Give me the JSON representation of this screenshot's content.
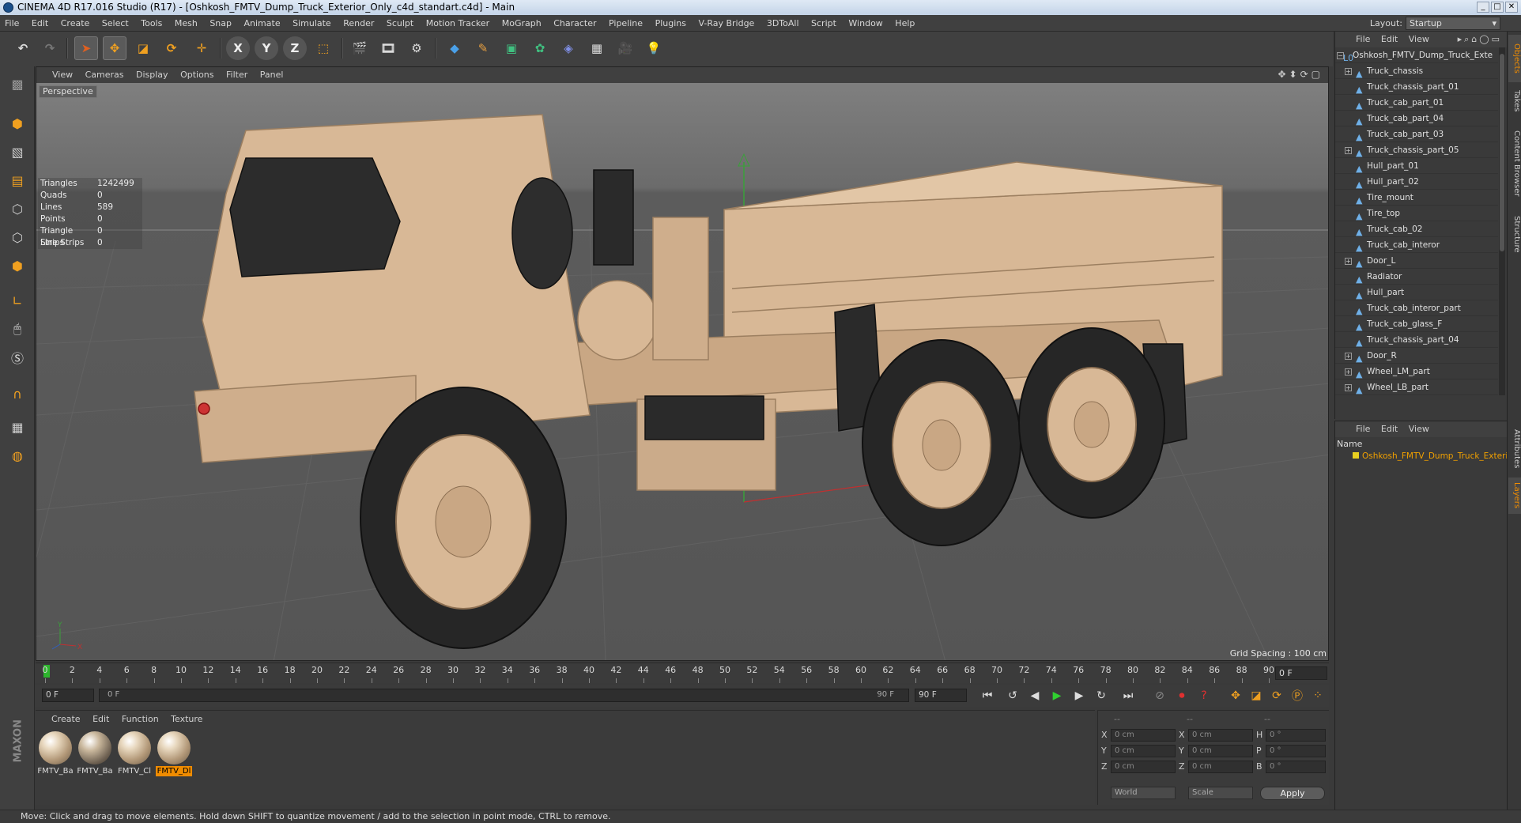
{
  "window": {
    "title": "CINEMA 4D R17.016 Studio (R17) - [Oshkosh_FMTV_Dump_Truck_Exterior_Only_c4d_standart.c4d] - Main"
  },
  "menubar": {
    "items": [
      "File",
      "Edit",
      "Create",
      "Select",
      "Tools",
      "Mesh",
      "Snap",
      "Animate",
      "Simulate",
      "Render",
      "Sculpt",
      "Motion Tracker",
      "MoGraph",
      "Character",
      "Pipeline",
      "Plugins",
      "V-Ray Bridge",
      "3DToAll",
      "Script",
      "Window",
      "Help"
    ],
    "layout_label": "Layout:",
    "layout_value": "Startup"
  },
  "viewport": {
    "menu": [
      "View",
      "Cameras",
      "Display",
      "Options",
      "Filter",
      "Panel"
    ],
    "label": "Perspective",
    "grid_spacing": "Grid Spacing : 100 cm",
    "stats": [
      {
        "k": "Triangles",
        "v": "1242499"
      },
      {
        "k": "Quads",
        "v": "0"
      },
      {
        "k": "Lines",
        "v": "589"
      },
      {
        "k": "Points",
        "v": "0"
      },
      {
        "k": "Triangle Strips",
        "v": "0"
      },
      {
        "k": "Line Strips",
        "v": "0"
      }
    ],
    "truck_color": "#d8b896"
  },
  "timeline": {
    "ticks": [
      "0",
      "2",
      "4",
      "6",
      "8",
      "10",
      "12",
      "14",
      "16",
      "18",
      "20",
      "22",
      "24",
      "26",
      "28",
      "30",
      "32",
      "34",
      "36",
      "38",
      "40",
      "42",
      "44",
      "46",
      "48",
      "50",
      "52",
      "54",
      "56",
      "58",
      "60",
      "62",
      "64",
      "66",
      "68",
      "70",
      "72",
      "74",
      "76",
      "78",
      "80",
      "82",
      "84",
      "86",
      "88",
      "90"
    ],
    "current_frame": "0 F"
  },
  "transport": {
    "start_field": "0 F",
    "range_start": "0 F",
    "range_end": "90 F",
    "end_field": "90 F"
  },
  "materials": {
    "menu": [
      "Create",
      "Edit",
      "Function",
      "Texture"
    ],
    "items": [
      {
        "label": "FMTV_Ba"
      },
      {
        "label": "FMTV_Ba"
      },
      {
        "label": "FMTV_Cl"
      },
      {
        "label": "FMTV_Dl"
      }
    ]
  },
  "coords": {
    "header": [
      "--",
      "--",
      "--"
    ],
    "rows": [
      {
        "a": "X",
        "v1": "0 cm",
        "b": "X",
        "v2": "0 cm",
        "c": "H",
        "v3": "0 °"
      },
      {
        "a": "Y",
        "v1": "0 cm",
        "b": "Y",
        "v2": "0 cm",
        "c": "P",
        "v3": "0 °"
      },
      {
        "a": "Z",
        "v1": "0 cm",
        "b": "Z",
        "v2": "0 cm",
        "c": "B",
        "v3": "0 °"
      }
    ],
    "mode1": "World",
    "mode2": "Scale",
    "apply": "Apply"
  },
  "object_manager": {
    "menu": [
      "File",
      "Edit",
      "View"
    ],
    "root": "Oshkosh_FMTV_Dump_Truck_Exte",
    "objects": [
      {
        "name": "Truck_chassis",
        "expandable": true
      },
      {
        "name": "Truck_chassis_part_01",
        "expandable": false
      },
      {
        "name": "Truck_cab_part_01",
        "expandable": false
      },
      {
        "name": "Truck_cab_part_04",
        "expandable": false
      },
      {
        "name": "Truck_cab_part_03",
        "expandable": false
      },
      {
        "name": "Truck_chassis_part_05",
        "expandable": true
      },
      {
        "name": "Hull_part_01",
        "expandable": false
      },
      {
        "name": "Hull_part_02",
        "expandable": false
      },
      {
        "name": "Tire_mount",
        "expandable": false
      },
      {
        "name": "Tire_top",
        "expandable": false
      },
      {
        "name": "Truck_cab_02",
        "expandable": false
      },
      {
        "name": "Truck_cab_interor",
        "expandable": false
      },
      {
        "name": "Door_L",
        "expandable": true
      },
      {
        "name": "Radiator",
        "expandable": false
      },
      {
        "name": "Hull_part",
        "expandable": false
      },
      {
        "name": "Truck_cab_interor_part",
        "expandable": false
      },
      {
        "name": "Truck_cab_glass_F",
        "expandable": false
      },
      {
        "name": "Truck_chassis_part_04",
        "expandable": false
      },
      {
        "name": "Door_R",
        "expandable": true
      },
      {
        "name": "Wheel_LM_part",
        "expandable": true
      },
      {
        "name": "Wheel_LB_part",
        "expandable": true
      }
    ]
  },
  "layer_manager": {
    "menu": [
      "File",
      "Edit",
      "View"
    ],
    "column": "Name",
    "layer": "Oshkosh_FMTV_Dump_Truck_Exteri"
  },
  "side_tabs": [
    "Objects",
    "Takes",
    "Content Browser",
    "Structure",
    "Attributes",
    "Layers"
  ],
  "status": "Move: Click and drag to move elements. Hold down SHIFT to quantize movement / add to the selection in point mode, CTRL to remove."
}
